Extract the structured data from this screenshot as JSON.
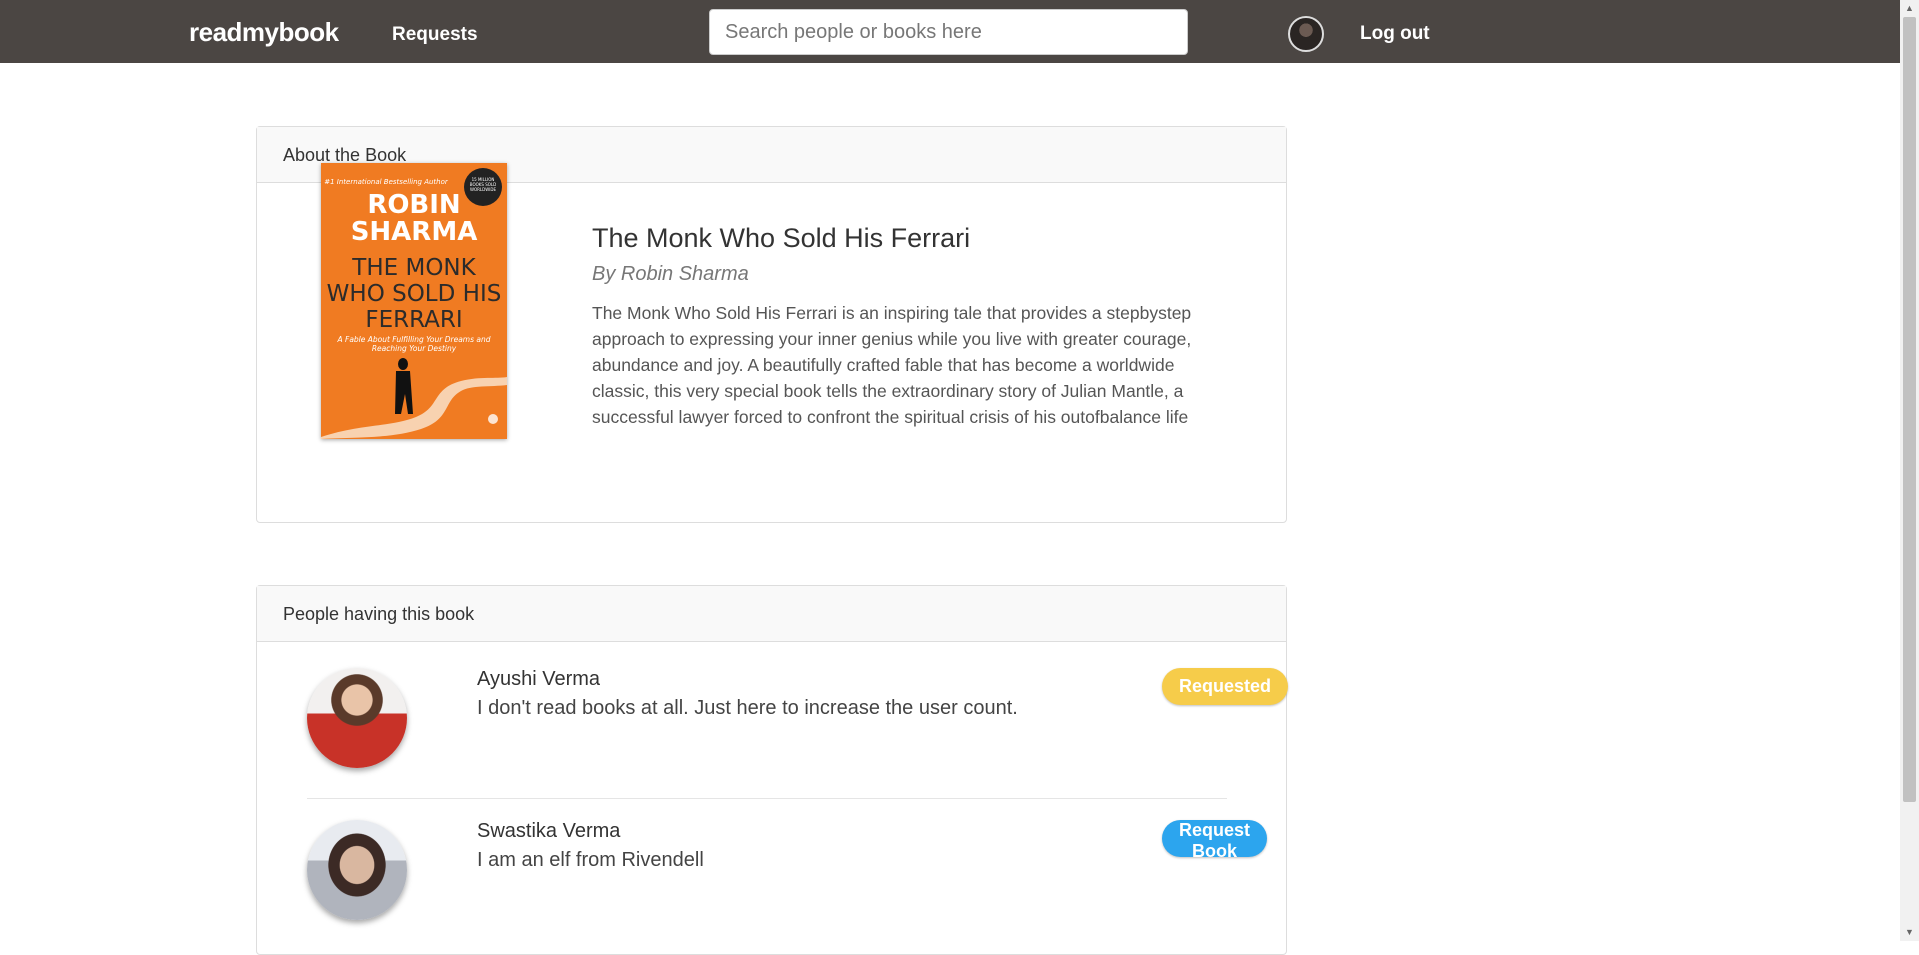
{
  "header": {
    "brand": "readmybook",
    "nav_requests": "Requests",
    "search_placeholder": "Search people or books here",
    "logout": "Log out"
  },
  "book_panel": {
    "heading": "About the Book",
    "title": "The Monk Who Sold His Ferrari",
    "author": "By Robin Sharma",
    "description": "The Monk Who Sold His Ferrari is an inspiring tale that provides a stepbystep approach to expressing your inner genius while you live with greater courage, abundance and joy. A beautifully crafted fable that has become a worldwide classic, this very special book tells the extraordinary story of Julian Mantle, a successful lawyer forced to confront the spiritual crisis of his outofbalance life",
    "cover": {
      "tagline": "#1 International Bestselling Author",
      "author": "ROBIN SHARMA",
      "title": "THE MONK WHO SOLD HIS FERRARI",
      "subtitle": "A Fable About Fulfilling Your Dreams and Reaching Your Destiny",
      "badge": "15 MILLION BOOKS SOLD WORLDWIDE",
      "color": "#f07b22"
    }
  },
  "people_panel": {
    "heading": "People having this book",
    "people": [
      {
        "name": "Ayushi Verma",
        "bio": "I don't read books at all. Just here to increase the user count.",
        "action": "Requested",
        "action_color": "#f6cc4a"
      },
      {
        "name": "Swastika Verma",
        "bio": "I am an elf from Rivendell",
        "action": "Request Book",
        "action_color": "#2ca5ee"
      }
    ]
  },
  "colors": {
    "header_bg": "#4b4643",
    "panel_head_bg": "#f9f9f9"
  }
}
